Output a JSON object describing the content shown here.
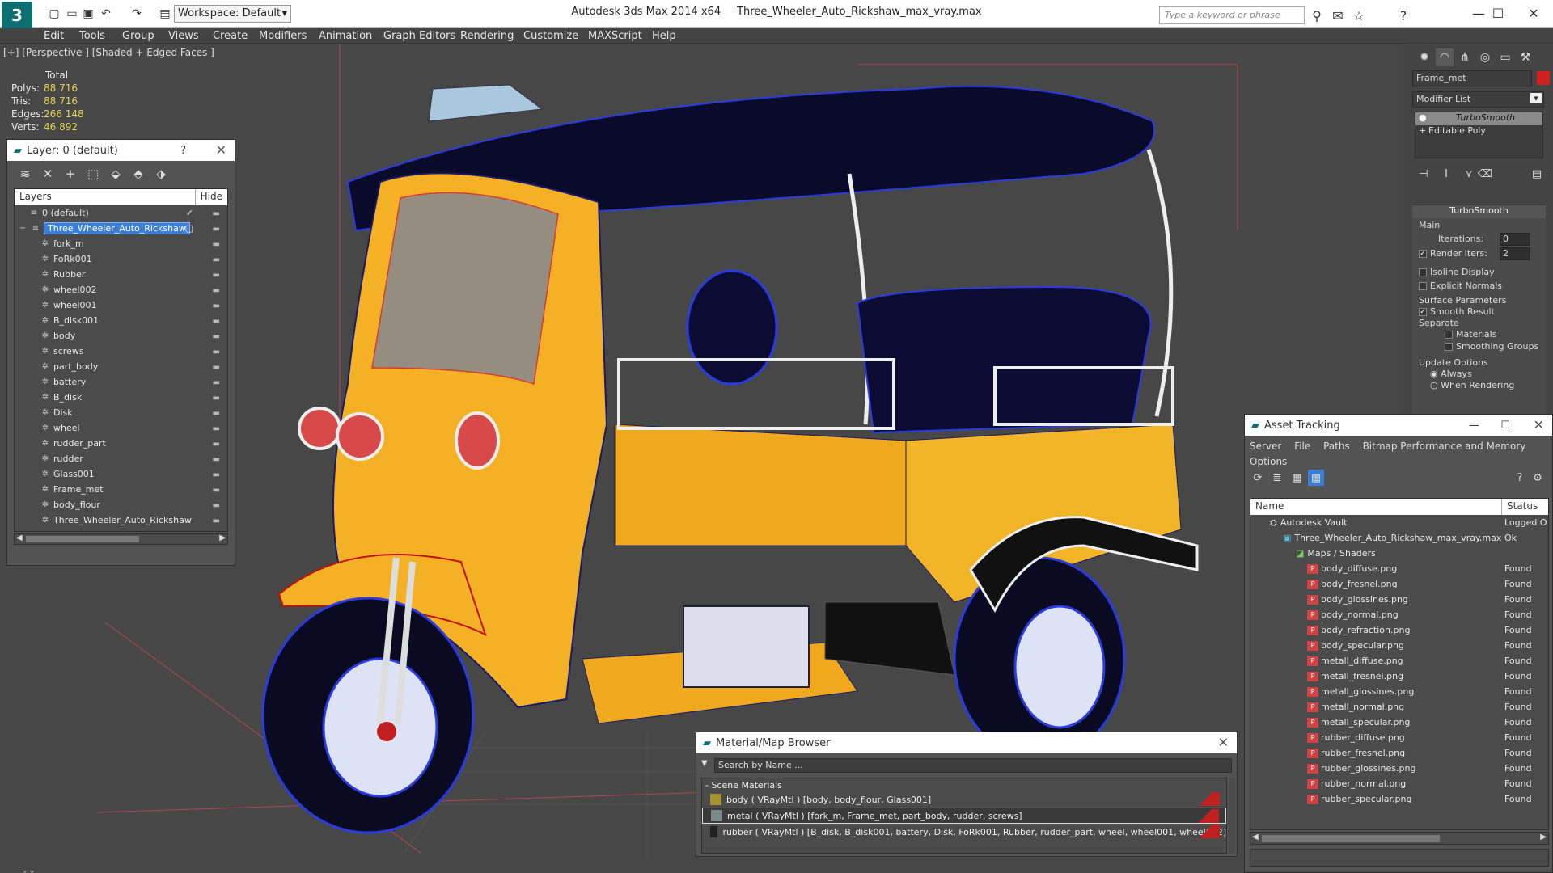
{
  "app": {
    "title": "Autodesk 3ds Max  2014 x64",
    "file": "Three_Wheeler_Auto_Rickshaw_max_vray.max",
    "workspace": "Workspace: Default",
    "search_placeholder": "Type a keyword or phrase"
  },
  "menu": [
    "Edit",
    "Tools",
    "Group",
    "Views",
    "Create",
    "Modifiers",
    "Animation",
    "Graph Editors",
    "Rendering",
    "Customize",
    "MAXScript",
    "Help"
  ],
  "viewport": {
    "label": "[+] [Perspective ] [Shaded + Edged Faces ]",
    "stats": {
      "header": "Total",
      "rows": [
        {
          "label": "Polys:",
          "value": "88 716"
        },
        {
          "label": "Tris:",
          "value": "88 716"
        },
        {
          "label": "Edges:",
          "value": "266 148"
        },
        {
          "label": "Verts:",
          "value": "46 892"
        }
      ]
    }
  },
  "layer_window": {
    "title": "Layer: 0 (default)",
    "help": "?",
    "col_layers": "Layers",
    "col_hide": "Hide",
    "rows": [
      "0 (default)",
      "Three_Wheeler_Auto_Rickshaw",
      "fork_m",
      "FoRk001",
      "Rubber",
      "wheel002",
      "wheel001",
      "B_disk001",
      "body",
      "screws",
      "part_body",
      "battery",
      "B_disk",
      "Disk",
      "wheel",
      "rudder_part",
      "rudder",
      "Glass001",
      "Frame_met",
      "body_flour",
      "Three_Wheeler_Auto_Rickshaw"
    ]
  },
  "command_panel": {
    "object_name": "Frame_met",
    "object_color": "#d02020",
    "modifier_list": "Modifier List",
    "stack": [
      "TurboSmooth",
      "Editable Poly"
    ],
    "rollout": "TurboSmooth",
    "main": "Main",
    "iterations_label": "Iterations:",
    "iterations": "0",
    "render_iters_label": "Render Iters:",
    "render_iters": "2",
    "isoline": "Isoline Display",
    "explicit": "Explicit Normals",
    "surface": "Surface Parameters",
    "smooth_result": "Smooth Result",
    "separate": "Separate",
    "materials": "Materials",
    "smoothing_groups": "Smoothing Groups",
    "update": "Update Options",
    "always": "Always",
    "when_rendering": "When Rendering"
  },
  "asset_tracking": {
    "title": "Asset Tracking",
    "menu": [
      "Server",
      "File",
      "Paths",
      "Bitmap Performance and Memory"
    ],
    "options": "Options",
    "col_name": "Name",
    "col_status": "Status",
    "rows": [
      {
        "name": "Autodesk Vault",
        "status": "Logged O",
        "indent": 1
      },
      {
        "name": "Three_Wheeler_Auto_Rickshaw_max_vray.max",
        "status": "Ok",
        "indent": 2
      },
      {
        "name": "Maps / Shaders",
        "status": "",
        "indent": 3
      },
      {
        "name": "body_diffuse.png",
        "status": "Found",
        "indent": 4
      },
      {
        "name": "body_fresnel.png",
        "status": "Found",
        "indent": 4
      },
      {
        "name": "body_glossines.png",
        "status": "Found",
        "indent": 4
      },
      {
        "name": "body_normal.png",
        "status": "Found",
        "indent": 4
      },
      {
        "name": "body_refraction.png",
        "status": "Found",
        "indent": 4
      },
      {
        "name": "body_specular.png",
        "status": "Found",
        "indent": 4
      },
      {
        "name": "metall_diffuse.png",
        "status": "Found",
        "indent": 4
      },
      {
        "name": "metall_fresnel.png",
        "status": "Found",
        "indent": 4
      },
      {
        "name": "metall_glossines.png",
        "status": "Found",
        "indent": 4
      },
      {
        "name": "metall_normal.png",
        "status": "Found",
        "indent": 4
      },
      {
        "name": "metall_specular.png",
        "status": "Found",
        "indent": 4
      },
      {
        "name": "rubber_diffuse.png",
        "status": "Found",
        "indent": 4
      },
      {
        "name": "rubber_fresnel.png",
        "status": "Found",
        "indent": 4
      },
      {
        "name": "rubber_glossines.png",
        "status": "Found",
        "indent": 4
      },
      {
        "name": "rubber_normal.png",
        "status": "Found",
        "indent": 4
      },
      {
        "name": "rubber_specular.png",
        "status": "Found",
        "indent": 4
      }
    ]
  },
  "material_browser": {
    "title": "Material/Map Browser",
    "search": "Search by Name ...",
    "section": "- Scene Materials",
    "rows": [
      "body  ( VRayMtl ) [body, body_flour, Glass001]",
      "metal  ( VRayMtl ) [fork_m, Frame_met, part_body, rudder, screws]",
      "rubber  ( VRayMtl ) [B_disk, B_disk001, battery, Disk, FoRk001, Rubber, rudder_part, wheel, wheel001, wheel002]"
    ]
  }
}
